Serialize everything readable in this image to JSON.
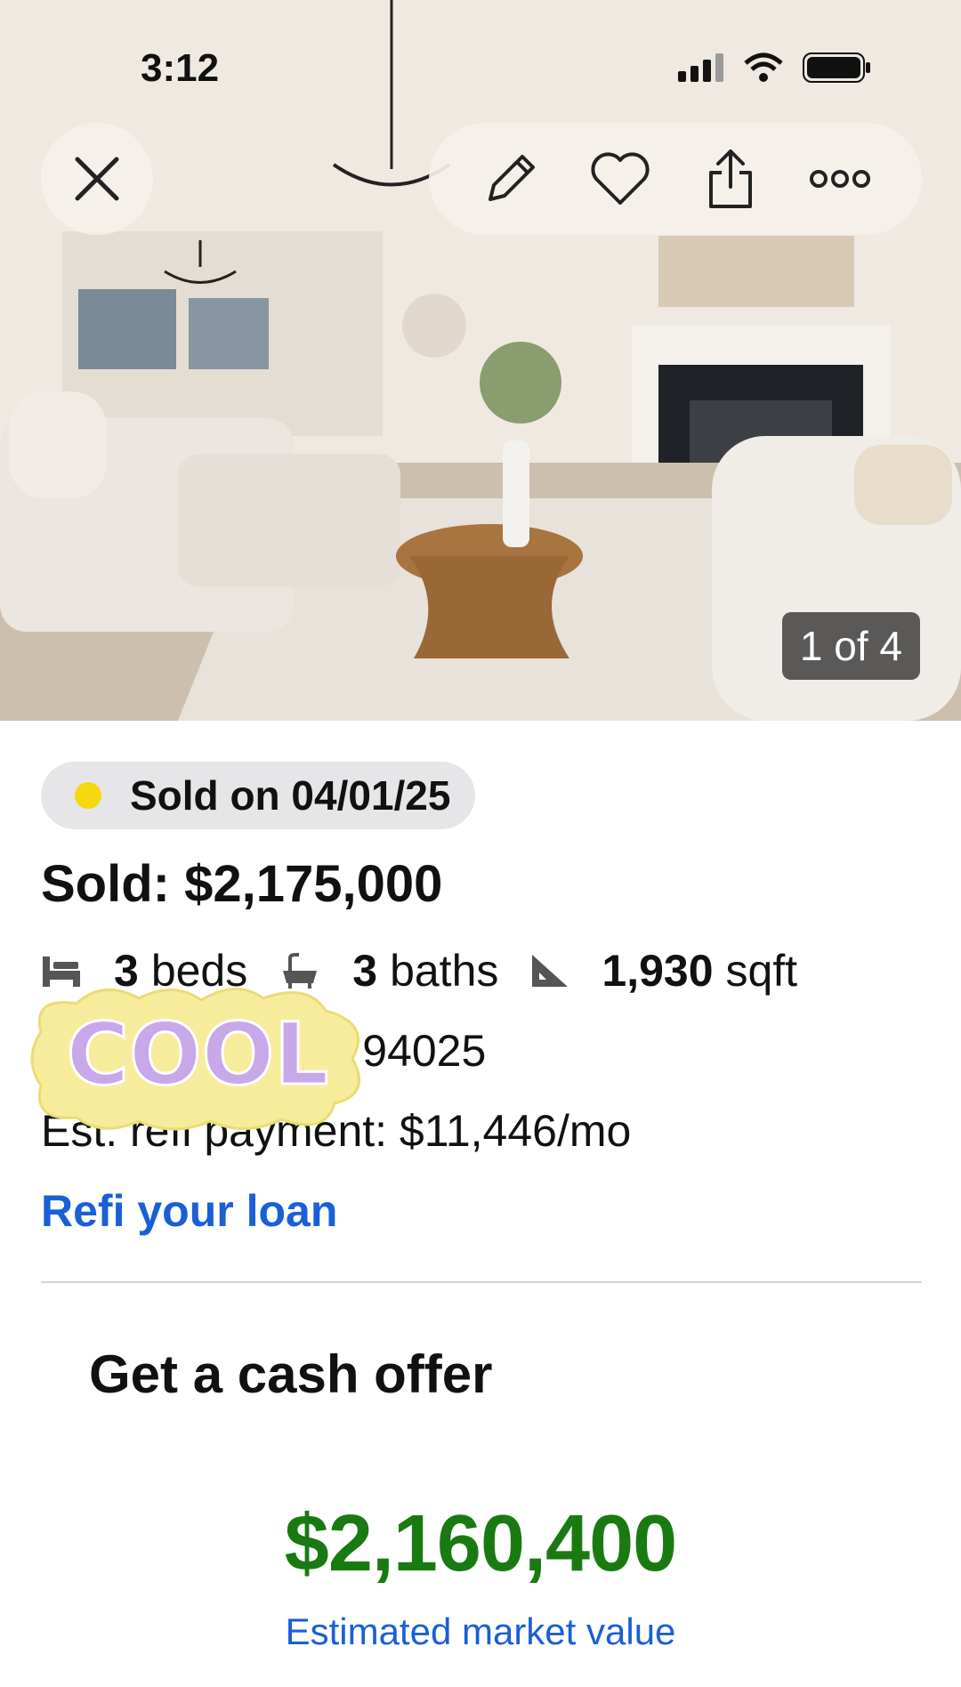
{
  "status_bar": {
    "time": "3:12"
  },
  "hero": {
    "photo_counter": "1 of 4"
  },
  "listing": {
    "sold_badge": "Sold on 04/01/25",
    "sold_price": "Sold: $2,175,000",
    "beds": {
      "value": "3",
      "unit": "beds"
    },
    "baths": {
      "value": "3",
      "unit": "baths"
    },
    "sqft": {
      "value": "1,930",
      "unit": "sqft"
    },
    "address": "Menlo Park, CA 94025",
    "payment": "Est. refi payment: $11,446/mo",
    "refi_link": "Refi your loan"
  },
  "cash_offer": {
    "title": "Get a cash offer",
    "value": "$2,160,400",
    "label": "Estimated market value"
  },
  "sticker": {
    "text": "COOL"
  },
  "colors": {
    "accent_blue": "#1a5fd6",
    "value_green": "#1a7a12",
    "sold_dot": "#f5d90f"
  },
  "icons": [
    "close-icon",
    "pencil-icon",
    "heart-icon",
    "share-icon",
    "more-icon",
    "bed-icon",
    "bath-icon",
    "ruler-icon"
  ]
}
